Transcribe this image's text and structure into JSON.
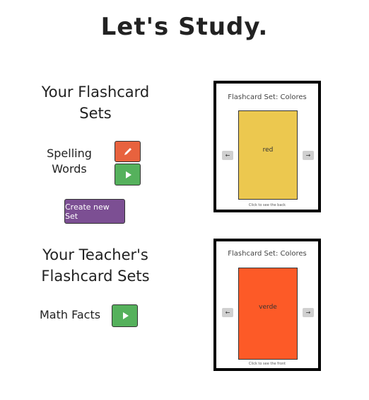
{
  "page": {
    "title": "Let's Study."
  },
  "my_sets": {
    "heading_line1": "Your Flashcard",
    "heading_line2": "Sets",
    "items": [
      {
        "name_line1": "Spelling",
        "name_line2": "Words"
      }
    ],
    "create_label": "Create new Set"
  },
  "teacher_sets": {
    "heading_line1": "Your Teacher's",
    "heading_line2": "Flashcard Sets",
    "items": [
      {
        "name": "Math Facts"
      }
    ]
  },
  "viewers": [
    {
      "title": "Flashcard Set: Colores",
      "card_text": "red",
      "card_color": "#ecc84f",
      "hint": "Click to see the back"
    },
    {
      "title": "Flashcard Set: Colores",
      "card_text": "verde",
      "card_color": "#fd5a27",
      "hint": "Click to see the front"
    }
  ],
  "colors": {
    "edit_button": "#e8623e",
    "play_button": "#55b15c",
    "create_button": "#7c4f93"
  },
  "icons": {
    "edit": "pencil-icon",
    "play": "play-icon",
    "prev": "arrow-left-icon",
    "next": "arrow-right-icon"
  }
}
